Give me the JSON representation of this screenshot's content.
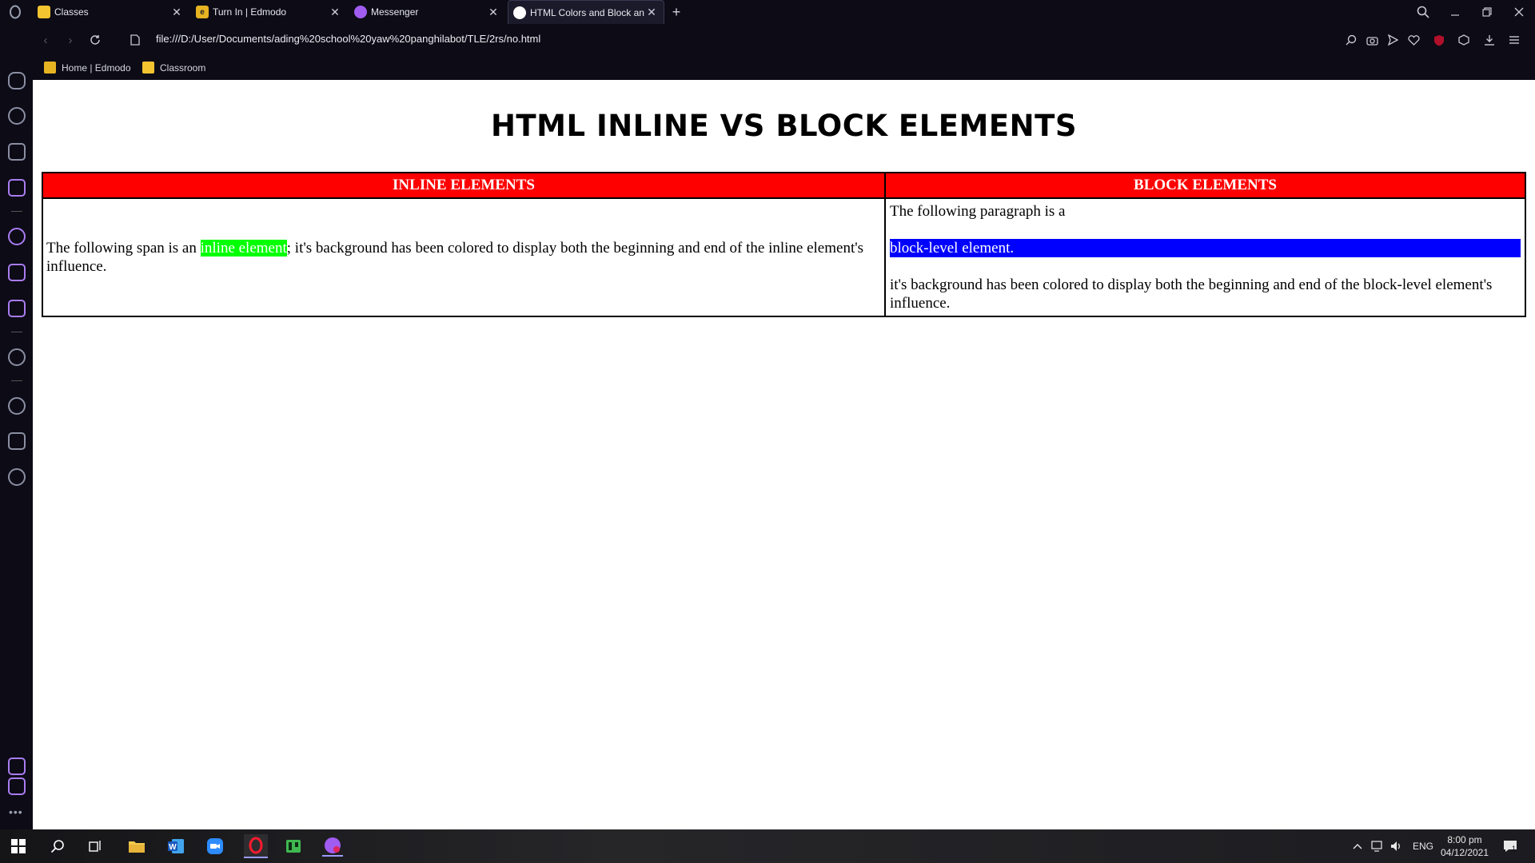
{
  "browser": {
    "tabs": [
      {
        "title": "Classes",
        "close": "✕",
        "favicon_color": "#f4c430"
      },
      {
        "title": "Turn In | Edmodo",
        "close": "✕",
        "favicon_color": "#e6b422"
      },
      {
        "title": "Messenger",
        "close": "✕",
        "favicon_color": "#a05cf0"
      },
      {
        "title": "HTML Colors and Block an",
        "close": "✕",
        "favicon_color": "#ffffff"
      }
    ],
    "new_tab": "+",
    "url": "file:///D:/User/Documents/ading%20school%20yaw%20panghilabot/TLE/2rs/no.html",
    "bookmarks": [
      {
        "label": "Home | Edmodo"
      },
      {
        "label": "Classroom"
      }
    ]
  },
  "page": {
    "title": "HTML INLINE VS BLOCK ELEMENTS",
    "table": {
      "headers": [
        "INLINE ELEMENTS",
        "BLOCK ELEMENTS"
      ],
      "inline": {
        "before": "The following span is an ",
        "highlight": "inline element",
        "after": "; it's background has been colored to display both the beginning and end of the inline element's influence.",
        "highlight_color": "#00ff00"
      },
      "block": {
        "intro": "The following paragraph is a",
        "highlight": "block-level element.",
        "outro": "it's background has been colored to display both the beginning and end of the block-level element's influence.",
        "highlight_color": "#0000ff"
      },
      "header_color": "#ff0000"
    }
  },
  "taskbar": {
    "language": "ENG",
    "time": "8:00 pm",
    "date": "04/12/2021",
    "notification_count": "1"
  }
}
